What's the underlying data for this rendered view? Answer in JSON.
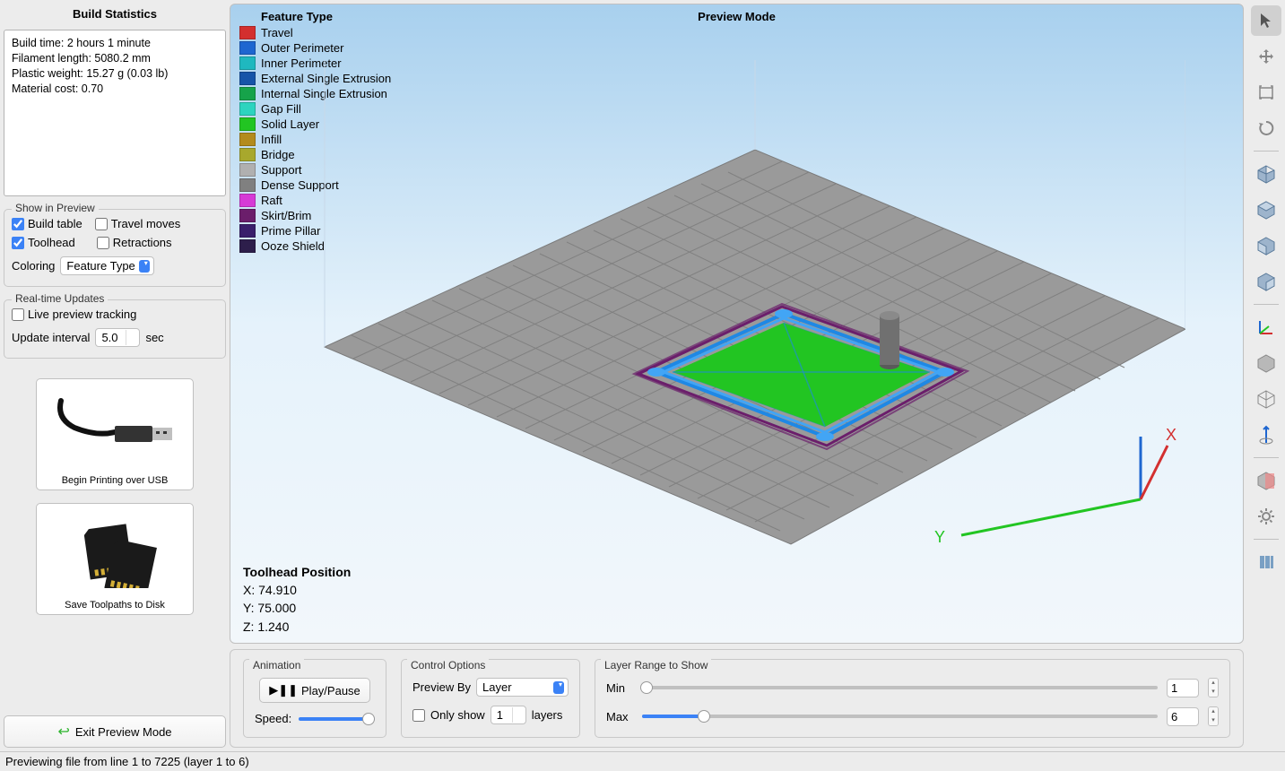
{
  "sidebar": {
    "title": "Build Statistics",
    "stats": {
      "build_time": "Build time: 2 hours 1 minute",
      "filament": "Filament length: 5080.2 mm",
      "weight": "Plastic weight: 15.27 g (0.03 lb)",
      "cost": "Material cost: 0.70"
    },
    "show_in_preview": {
      "title": "Show in Preview",
      "build_table": {
        "label": "Build table",
        "checked": true
      },
      "travel_moves": {
        "label": "Travel moves",
        "checked": false
      },
      "toolhead": {
        "label": "Toolhead",
        "checked": true
      },
      "retractions": {
        "label": "Retractions",
        "checked": false
      },
      "coloring_label": "Coloring",
      "coloring_value": "Feature Type"
    },
    "realtime": {
      "title": "Real-time Updates",
      "live_tracking": {
        "label": "Live preview tracking",
        "checked": false
      },
      "update_label": "Update interval",
      "update_value": "5.0",
      "update_unit": "sec"
    },
    "usb_card": "Begin Printing over USB",
    "disk_card": "Save Toolpaths to Disk",
    "exit_btn": "Exit Preview Mode"
  },
  "legend": {
    "title": "Feature Type",
    "items": [
      {
        "label": "Travel",
        "color": "#d32f2f"
      },
      {
        "label": "Outer Perimeter",
        "color": "#1e66d0"
      },
      {
        "label": "Inner Perimeter",
        "color": "#1fb8bf"
      },
      {
        "label": "External Single Extrusion",
        "color": "#1654a8"
      },
      {
        "label": "Internal Single Extrusion",
        "color": "#16a34a"
      },
      {
        "label": "Gap Fill",
        "color": "#2dd4bf"
      },
      {
        "label": "Solid Layer",
        "color": "#22c522"
      },
      {
        "label": "Infill",
        "color": "#b38b1d"
      },
      {
        "label": "Bridge",
        "color": "#a8a82d"
      },
      {
        "label": "Support",
        "color": "#b0b0b0"
      },
      {
        "label": "Dense Support",
        "color": "#808080"
      },
      {
        "label": "Raft",
        "color": "#d63ad6"
      },
      {
        "label": "Skirt/Brim",
        "color": "#6b1e6b"
      },
      {
        "label": "Prime Pillar",
        "color": "#3a1e6b"
      },
      {
        "label": "Ooze Shield",
        "color": "#2d1e4b"
      }
    ]
  },
  "preview_mode_title": "Preview Mode",
  "toolhead": {
    "title": "Toolhead Position",
    "x": "X: 74.910",
    "y": "Y: 75.000",
    "z": "Z: 1.240"
  },
  "bottom": {
    "animation": {
      "title": "Animation",
      "play": "Play/Pause",
      "speed": "Speed:"
    },
    "control": {
      "title": "Control Options",
      "preview_by_label": "Preview By",
      "preview_by_value": "Layer",
      "only_show_label": "Only show",
      "only_show_value": "1",
      "only_show_unit": "layers"
    },
    "range": {
      "title": "Layer Range to Show",
      "min_label": "Min",
      "min_value": "1",
      "max_label": "Max",
      "max_value": "6"
    }
  },
  "status": "Previewing file from line 1 to 7225 (layer 1 to 6)"
}
